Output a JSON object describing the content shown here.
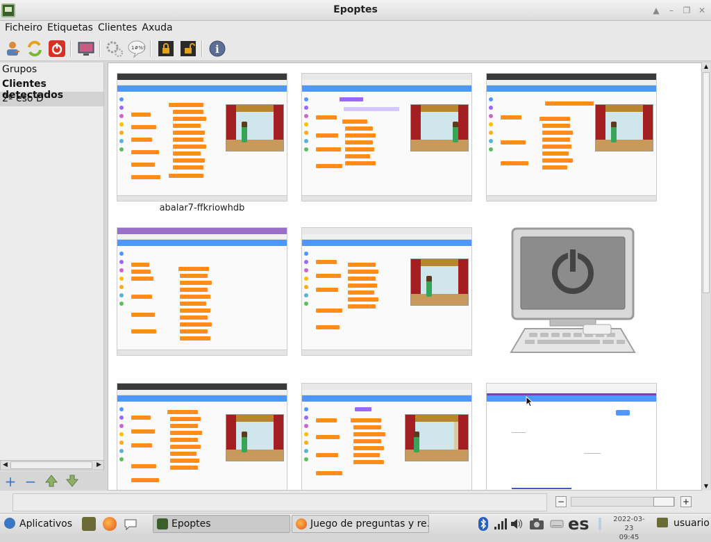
{
  "window": {
    "title": "Epoptes"
  },
  "menu": [
    {
      "label": "Ficheiro"
    },
    {
      "label": "Etiquetas"
    },
    {
      "label": "Clientes"
    },
    {
      "label": "Axuda"
    }
  ],
  "toolbar": {
    "buttons": [
      {
        "icon": "login-user-icon"
      },
      {
        "icon": "reboot-icon"
      },
      {
        "icon": "shutdown-icon"
      },
      {
        "icon": "broadcast-screen-icon"
      },
      {
        "icon": "execute-icon"
      },
      {
        "icon": "send-message-icon"
      },
      {
        "icon": "lock-screen-icon"
      },
      {
        "icon": "unlock-screen-icon"
      },
      {
        "icon": "info-icon"
      }
    ]
  },
  "sidebar": {
    "items": [
      {
        "label": "Grupos"
      },
      {
        "label": "Clientes detectados"
      },
      {
        "label": "2º eso D"
      }
    ]
  },
  "clients": [
    {
      "label": "abalar7-ffkriowhdb"
    },
    {
      "label": ""
    },
    {
      "label": ""
    },
    {
      "label": ""
    },
    {
      "label": ""
    },
    {
      "label": ""
    },
    {
      "label": ""
    },
    {
      "label": ""
    },
    {
      "label": ""
    }
  ],
  "taskbar": {
    "apps_label": "Aplicativos",
    "tasks": [
      {
        "label": "Epoptes"
      },
      {
        "label": "Juego de preguntas y re..."
      }
    ],
    "keyboard_layout": "es",
    "date": "2022-03-23",
    "time": "09:45",
    "user": "usuario"
  },
  "colors": {
    "scratch_orange": "#ff8c1a",
    "scratch_blue": "#4d97ff"
  }
}
